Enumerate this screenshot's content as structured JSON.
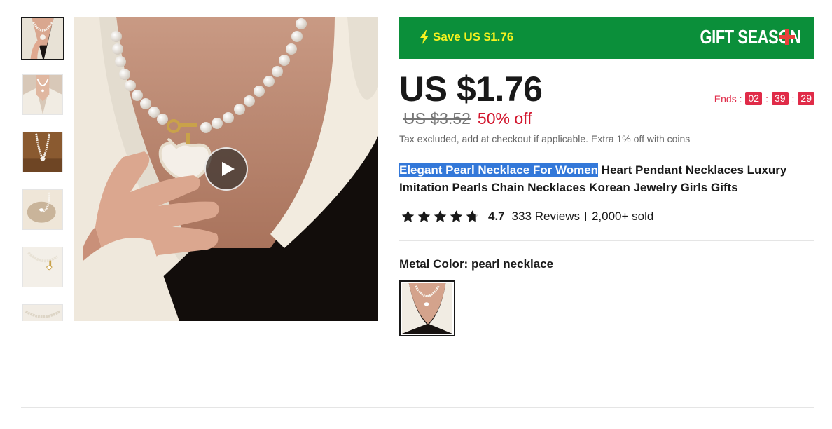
{
  "gallery": {
    "thumbnails": [
      "thumbnail-1",
      "thumbnail-2",
      "thumbnail-3",
      "thumbnail-4",
      "thumbnail-5",
      "thumbnail-6"
    ],
    "video_icon": "play-icon"
  },
  "promo": {
    "save_text": "Save US $1.76",
    "icon": "lightning-bolt-icon",
    "logo": "GIFT SEASON",
    "colors": {
      "background": "#0b8f3a",
      "save_text": "#f7f21f",
      "logo_cross": "#e8403a"
    }
  },
  "price": {
    "current": "US $1.76",
    "original": "US $3.52",
    "discount": "50% off",
    "tax_note": "Tax excluded, add at checkout if applicable. Extra 1% off with coins"
  },
  "countdown": {
    "label": "Ends :",
    "hours": "02",
    "minutes": "39",
    "seconds": "29",
    "separator": ":",
    "color": "#e02b48"
  },
  "product": {
    "title_highlighted": "Elegant Pearl Necklace For Women",
    "title_rest": " Heart Pendant Necklaces Luxury Imitation Pearls Chain Necklaces Korean Jewelry Girls Gifts",
    "rating": "4.7",
    "stars": 4.7,
    "reviews": "333 Reviews",
    "sold": "2,000+ sold"
  },
  "options": {
    "metal_color_label": "Metal Color: pearl necklace",
    "selected": "pearl necklace"
  }
}
